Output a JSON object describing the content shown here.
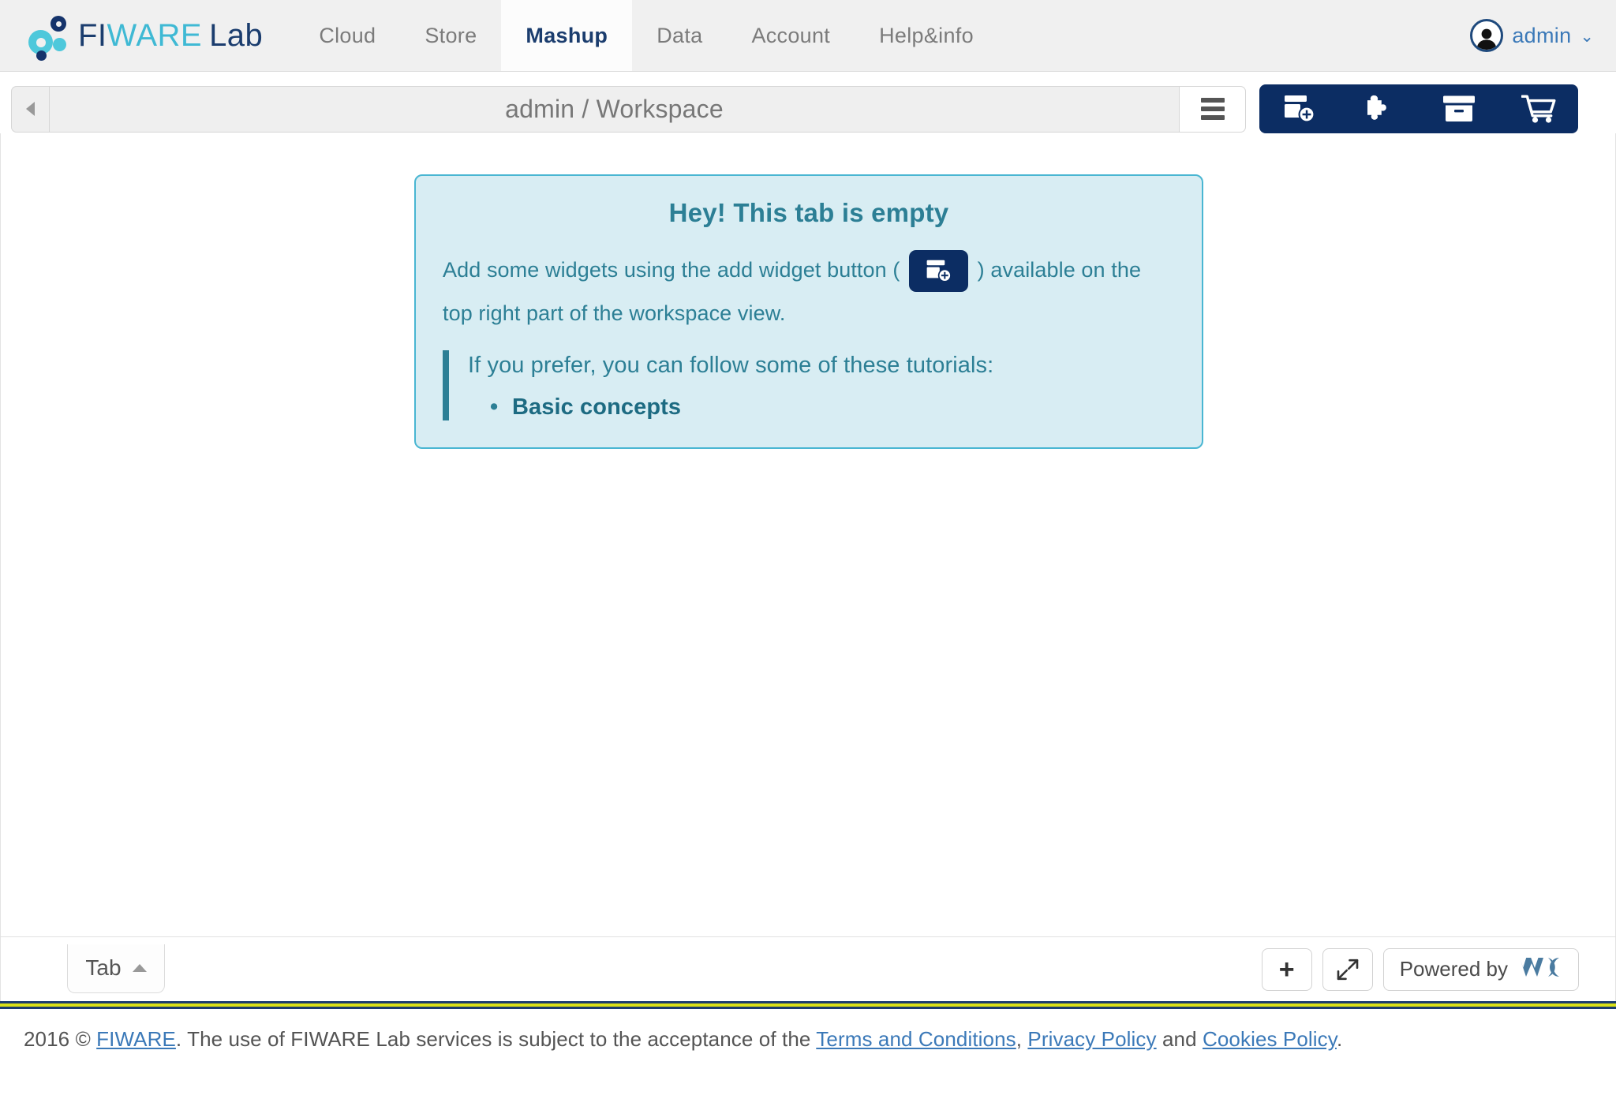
{
  "navbar": {
    "brand": {
      "fi": "FI",
      "ware": "WARE",
      "lab": "Lab"
    },
    "items": [
      {
        "label": "Cloud",
        "active": false
      },
      {
        "label": "Store",
        "active": false
      },
      {
        "label": "Mashup",
        "active": true
      },
      {
        "label": "Data",
        "active": false
      },
      {
        "label": "Account",
        "active": false
      },
      {
        "label": "Help&info",
        "active": false
      }
    ],
    "user": {
      "name": "admin"
    }
  },
  "workspace_bar": {
    "title": "admin / Workspace",
    "actions": [
      {
        "name": "add-widget",
        "title": "Add widget"
      },
      {
        "name": "wiring",
        "title": "Wiring"
      },
      {
        "name": "archive",
        "title": "Archive"
      },
      {
        "name": "marketplace",
        "title": "Marketplace"
      }
    ]
  },
  "empty_panel": {
    "title": "Hey! This tab is empty",
    "paragraph_before": "Add some widgets using the add widget button ( ",
    "paragraph_after": " ) available on the top right part of the workspace view.",
    "quote": "If you prefer, you can follow some of these tutorials:",
    "tutorials": [
      "Basic concepts"
    ]
  },
  "tabbar": {
    "tab_label": "Tab",
    "add_label": "+",
    "powered_label": "Powered by",
    "powered_logo": "WC"
  },
  "footer": {
    "year_copy": "2016 © ",
    "fiware_link": "FIWARE",
    "mid_1": ". The use of FIWARE Lab services is subject to the acceptance of the ",
    "terms_link": "Terms and Conditions",
    "mid_2": ", ",
    "privacy_link": "Privacy Policy",
    "mid_3": " and ",
    "cookies_link": "Cookies Policy",
    "end": "."
  },
  "colors": {
    "navy": "#0c2d63",
    "brand_navy": "#1b3d6e",
    "brand_cyan": "#3fb9d4",
    "panel_bg": "#d8edf3",
    "panel_border": "#49b6d2",
    "panel_text": "#2c7f95",
    "link_blue": "#3b79b8",
    "stripe_lime": "#d8e018"
  }
}
